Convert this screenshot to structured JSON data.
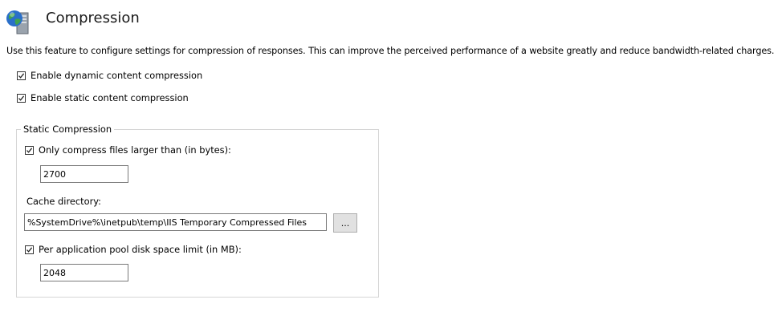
{
  "header": {
    "icon": "globe-server-icon",
    "title": "Compression"
  },
  "description": "Use this feature to configure settings for compression of responses. This can improve the perceived performance of a website greatly and reduce bandwidth-related charges.",
  "options": {
    "dynamic_label": "Enable dynamic content compression",
    "dynamic_checked": true,
    "static_label": "Enable static content compression",
    "static_checked": true
  },
  "static_compression": {
    "legend": "Static Compression",
    "min_size_label": "Only compress files larger than (in bytes):",
    "min_size_checked": true,
    "min_size_value": "2700",
    "cache_dir_label": "Cache directory:",
    "cache_dir_value": "%SystemDrive%\\inetpub\\temp\\IIS Temporary Compressed Files",
    "browse_label": "...",
    "disk_limit_label": "Per application pool disk space limit (in MB):",
    "disk_limit_checked": true,
    "disk_limit_value": "2048"
  },
  "colors": {
    "globe_blue": "#2a6fc9",
    "globe_green": "#3fa34d",
    "groupbox_border": "#d5d5d5",
    "button_face": "#e1e1e1"
  }
}
